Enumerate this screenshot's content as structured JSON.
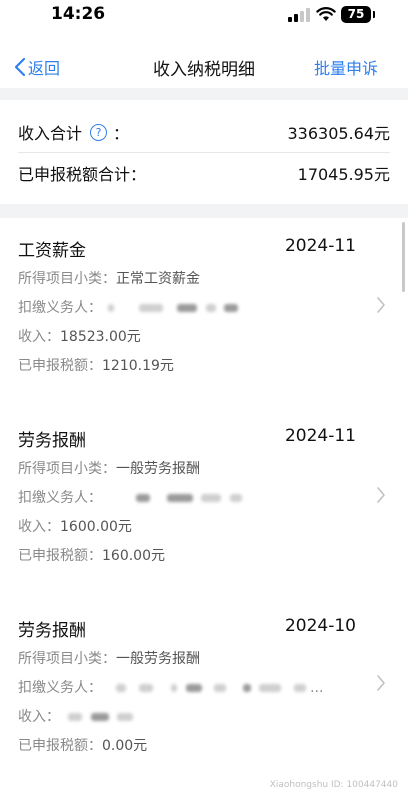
{
  "status_bar": {
    "time": "14:26",
    "battery": "75"
  },
  "nav": {
    "back_label": "返回",
    "title": "收入纳税明细",
    "action_label": "批量申诉"
  },
  "summary": {
    "income_total_label": "收入合计",
    "income_total_suffix": "：",
    "income_total_value": "336305.64元",
    "tax_total_label": "已申报税额合计：",
    "tax_total_value": "17045.95元"
  },
  "records": [
    {
      "type": "工资薪金",
      "period": "2024-11",
      "subcategory_label": "所得项目小类：",
      "subcategory": "正常工资薪金",
      "withholder_label": "扣缴义务人：",
      "income_label": "收入：",
      "income": "18523.00元",
      "tax_label": "已申报税额：",
      "tax": "1210.19元"
    },
    {
      "type": "劳务报酬",
      "period": "2024-11",
      "subcategory_label": "所得项目小类：",
      "subcategory": "一般劳务报酬",
      "withholder_label": "扣缴义务人：",
      "income_label": "收入：",
      "income": "1600.00元",
      "tax_label": "已申报税额：",
      "tax": "160.00元"
    },
    {
      "type": "劳务报酬",
      "period": "2024-10",
      "subcategory_label": "所得项目小类：",
      "subcategory": "一般劳务报酬",
      "withholder_label": "扣缴义务人：",
      "withholder_suffix": "...",
      "income_label": "收入：",
      "income": "",
      "tax_label": "已申报税额：",
      "tax": "0.00元"
    }
  ],
  "watermark": "Xiaohongshu ID: 100447440",
  "colors": {
    "accent": "#2f80ed",
    "band": "#f2f3f5",
    "secondary_text": "#8a8a8a"
  }
}
